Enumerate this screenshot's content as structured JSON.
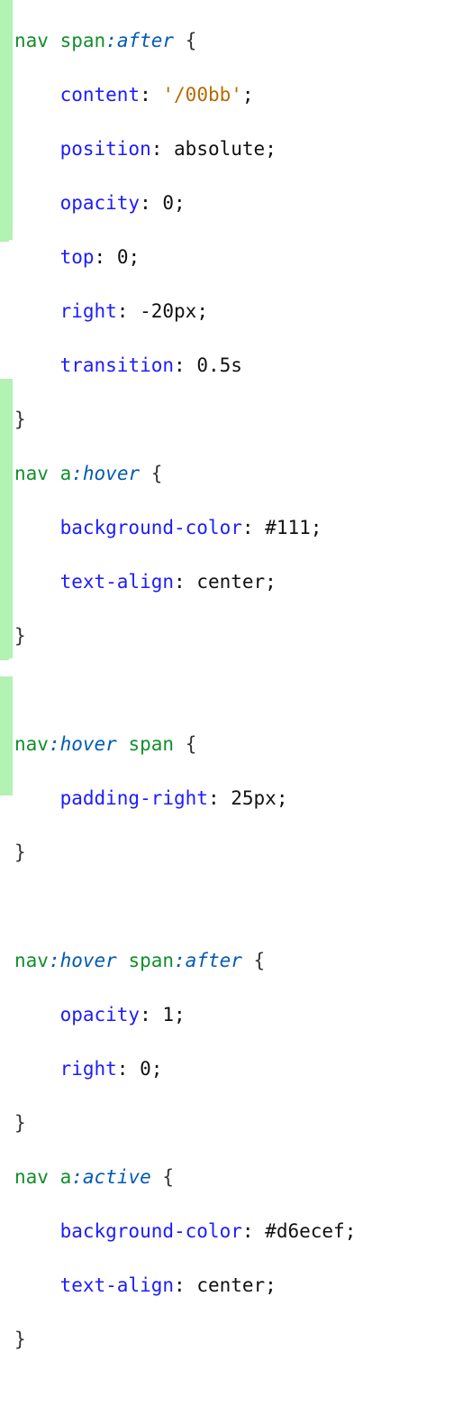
{
  "code": {
    "rule1": {
      "selector_a": "nav",
      "selector_b": "span",
      "pseudo": ":after",
      "decls": {
        "content_k": "content",
        "content_v": "'/00bb'",
        "position_k": "position",
        "position_v": "absolute",
        "opacity_k": "opacity",
        "opacity_v": "0",
        "top_k": "top",
        "top_v": "0",
        "right_k": "right",
        "right_v": "-20px",
        "transition_k": "transition",
        "transition_v": "0.5s"
      }
    },
    "rule2": {
      "selector_a": "nav",
      "selector_b": "a",
      "pseudo": ":hover",
      "decls": {
        "bg_k": "background-color",
        "bg_v": "#111",
        "ta_k": "text-align",
        "ta_v": "center"
      }
    },
    "rule3": {
      "selector_a": "nav",
      "pseudo": ":hover",
      "selector_b": "span",
      "decls": {
        "pr_k": "padding-right",
        "pr_v": "25px"
      }
    },
    "rule4": {
      "selector_a": "nav",
      "pseudo1": ":hover",
      "selector_b": "span",
      "pseudo2": ":after",
      "decls": {
        "op_k": "opacity",
        "op_v": "1",
        "right_k": "right",
        "right_v": "0"
      }
    },
    "rule5": {
      "selector_a": "nav",
      "selector_b": "a",
      "pseudo": ":active",
      "decls": {
        "bg_k": "background-color",
        "bg_v": "#d6ecef",
        "ta_k": "text-align",
        "ta_v": "center"
      }
    },
    "tokens": {
      "space": " ",
      "open": "{",
      "close": "}",
      "colon": ":",
      "semi": ";"
    }
  }
}
